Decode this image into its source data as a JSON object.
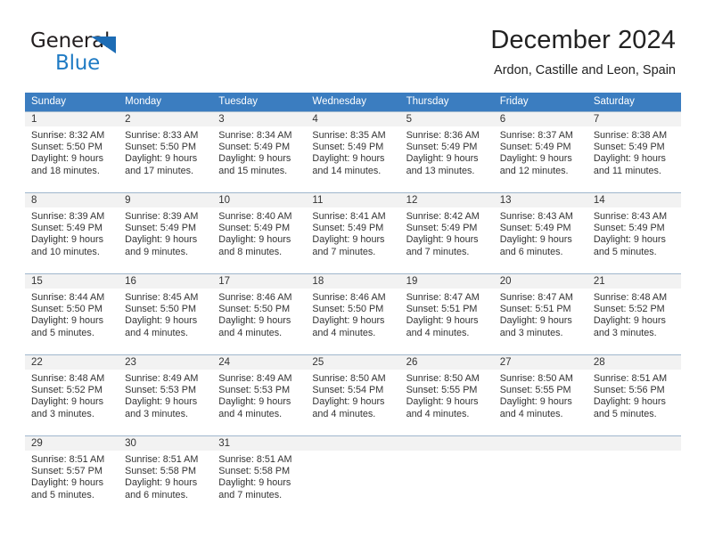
{
  "brand": {
    "name_part1": "General",
    "name_part2": "Blue",
    "accent_color": "#1f7bc4",
    "triangle_color": "#1c6cb5"
  },
  "header": {
    "title": "December 2024",
    "subtitle": "Ardon, Castille and Leon, Spain"
  },
  "calendar": {
    "header_bg": "#3b7dc0",
    "daynum_bg": "#f2f2f2",
    "weekdays": [
      "Sunday",
      "Monday",
      "Tuesday",
      "Wednesday",
      "Thursday",
      "Friday",
      "Saturday"
    ],
    "weeks": [
      {
        "days": [
          {
            "num": "1",
            "sunrise": "Sunrise: 8:32 AM",
            "sunset": "Sunset: 5:50 PM",
            "daylight1": "Daylight: 9 hours",
            "daylight2": "and 18 minutes."
          },
          {
            "num": "2",
            "sunrise": "Sunrise: 8:33 AM",
            "sunset": "Sunset: 5:50 PM",
            "daylight1": "Daylight: 9 hours",
            "daylight2": "and 17 minutes."
          },
          {
            "num": "3",
            "sunrise": "Sunrise: 8:34 AM",
            "sunset": "Sunset: 5:49 PM",
            "daylight1": "Daylight: 9 hours",
            "daylight2": "and 15 minutes."
          },
          {
            "num": "4",
            "sunrise": "Sunrise: 8:35 AM",
            "sunset": "Sunset: 5:49 PM",
            "daylight1": "Daylight: 9 hours",
            "daylight2": "and 14 minutes."
          },
          {
            "num": "5",
            "sunrise": "Sunrise: 8:36 AM",
            "sunset": "Sunset: 5:49 PM",
            "daylight1": "Daylight: 9 hours",
            "daylight2": "and 13 minutes."
          },
          {
            "num": "6",
            "sunrise": "Sunrise: 8:37 AM",
            "sunset": "Sunset: 5:49 PM",
            "daylight1": "Daylight: 9 hours",
            "daylight2": "and 12 minutes."
          },
          {
            "num": "7",
            "sunrise": "Sunrise: 8:38 AM",
            "sunset": "Sunset: 5:49 PM",
            "daylight1": "Daylight: 9 hours",
            "daylight2": "and 11 minutes."
          }
        ]
      },
      {
        "days": [
          {
            "num": "8",
            "sunrise": "Sunrise: 8:39 AM",
            "sunset": "Sunset: 5:49 PM",
            "daylight1": "Daylight: 9 hours",
            "daylight2": "and 10 minutes."
          },
          {
            "num": "9",
            "sunrise": "Sunrise: 8:39 AM",
            "sunset": "Sunset: 5:49 PM",
            "daylight1": "Daylight: 9 hours",
            "daylight2": "and 9 minutes."
          },
          {
            "num": "10",
            "sunrise": "Sunrise: 8:40 AM",
            "sunset": "Sunset: 5:49 PM",
            "daylight1": "Daylight: 9 hours",
            "daylight2": "and 8 minutes."
          },
          {
            "num": "11",
            "sunrise": "Sunrise: 8:41 AM",
            "sunset": "Sunset: 5:49 PM",
            "daylight1": "Daylight: 9 hours",
            "daylight2": "and 7 minutes."
          },
          {
            "num": "12",
            "sunrise": "Sunrise: 8:42 AM",
            "sunset": "Sunset: 5:49 PM",
            "daylight1": "Daylight: 9 hours",
            "daylight2": "and 7 minutes."
          },
          {
            "num": "13",
            "sunrise": "Sunrise: 8:43 AM",
            "sunset": "Sunset: 5:49 PM",
            "daylight1": "Daylight: 9 hours",
            "daylight2": "and 6 minutes."
          },
          {
            "num": "14",
            "sunrise": "Sunrise: 8:43 AM",
            "sunset": "Sunset: 5:49 PM",
            "daylight1": "Daylight: 9 hours",
            "daylight2": "and 5 minutes."
          }
        ]
      },
      {
        "days": [
          {
            "num": "15",
            "sunrise": "Sunrise: 8:44 AM",
            "sunset": "Sunset: 5:50 PM",
            "daylight1": "Daylight: 9 hours",
            "daylight2": "and 5 minutes."
          },
          {
            "num": "16",
            "sunrise": "Sunrise: 8:45 AM",
            "sunset": "Sunset: 5:50 PM",
            "daylight1": "Daylight: 9 hours",
            "daylight2": "and 4 minutes."
          },
          {
            "num": "17",
            "sunrise": "Sunrise: 8:46 AM",
            "sunset": "Sunset: 5:50 PM",
            "daylight1": "Daylight: 9 hours",
            "daylight2": "and 4 minutes."
          },
          {
            "num": "18",
            "sunrise": "Sunrise: 8:46 AM",
            "sunset": "Sunset: 5:50 PM",
            "daylight1": "Daylight: 9 hours",
            "daylight2": "and 4 minutes."
          },
          {
            "num": "19",
            "sunrise": "Sunrise: 8:47 AM",
            "sunset": "Sunset: 5:51 PM",
            "daylight1": "Daylight: 9 hours",
            "daylight2": "and 4 minutes."
          },
          {
            "num": "20",
            "sunrise": "Sunrise: 8:47 AM",
            "sunset": "Sunset: 5:51 PM",
            "daylight1": "Daylight: 9 hours",
            "daylight2": "and 3 minutes."
          },
          {
            "num": "21",
            "sunrise": "Sunrise: 8:48 AM",
            "sunset": "Sunset: 5:52 PM",
            "daylight1": "Daylight: 9 hours",
            "daylight2": "and 3 minutes."
          }
        ]
      },
      {
        "days": [
          {
            "num": "22",
            "sunrise": "Sunrise: 8:48 AM",
            "sunset": "Sunset: 5:52 PM",
            "daylight1": "Daylight: 9 hours",
            "daylight2": "and 3 minutes."
          },
          {
            "num": "23",
            "sunrise": "Sunrise: 8:49 AM",
            "sunset": "Sunset: 5:53 PM",
            "daylight1": "Daylight: 9 hours",
            "daylight2": "and 3 minutes."
          },
          {
            "num": "24",
            "sunrise": "Sunrise: 8:49 AM",
            "sunset": "Sunset: 5:53 PM",
            "daylight1": "Daylight: 9 hours",
            "daylight2": "and 4 minutes."
          },
          {
            "num": "25",
            "sunrise": "Sunrise: 8:50 AM",
            "sunset": "Sunset: 5:54 PM",
            "daylight1": "Daylight: 9 hours",
            "daylight2": "and 4 minutes."
          },
          {
            "num": "26",
            "sunrise": "Sunrise: 8:50 AM",
            "sunset": "Sunset: 5:55 PM",
            "daylight1": "Daylight: 9 hours",
            "daylight2": "and 4 minutes."
          },
          {
            "num": "27",
            "sunrise": "Sunrise: 8:50 AM",
            "sunset": "Sunset: 5:55 PM",
            "daylight1": "Daylight: 9 hours",
            "daylight2": "and 4 minutes."
          },
          {
            "num": "28",
            "sunrise": "Sunrise: 8:51 AM",
            "sunset": "Sunset: 5:56 PM",
            "daylight1": "Daylight: 9 hours",
            "daylight2": "and 5 minutes."
          }
        ]
      },
      {
        "days": [
          {
            "num": "29",
            "sunrise": "Sunrise: 8:51 AM",
            "sunset": "Sunset: 5:57 PM",
            "daylight1": "Daylight: 9 hours",
            "daylight2": "and 5 minutes."
          },
          {
            "num": "30",
            "sunrise": "Sunrise: 8:51 AM",
            "sunset": "Sunset: 5:58 PM",
            "daylight1": "Daylight: 9 hours",
            "daylight2": "and 6 minutes."
          },
          {
            "num": "31",
            "sunrise": "Sunrise: 8:51 AM",
            "sunset": "Sunset: 5:58 PM",
            "daylight1": "Daylight: 9 hours",
            "daylight2": "and 7 minutes."
          },
          {
            "num": "",
            "sunrise": "",
            "sunset": "",
            "daylight1": "",
            "daylight2": ""
          },
          {
            "num": "",
            "sunrise": "",
            "sunset": "",
            "daylight1": "",
            "daylight2": ""
          },
          {
            "num": "",
            "sunrise": "",
            "sunset": "",
            "daylight1": "",
            "daylight2": ""
          },
          {
            "num": "",
            "sunrise": "",
            "sunset": "",
            "daylight1": "",
            "daylight2": ""
          }
        ]
      }
    ]
  }
}
